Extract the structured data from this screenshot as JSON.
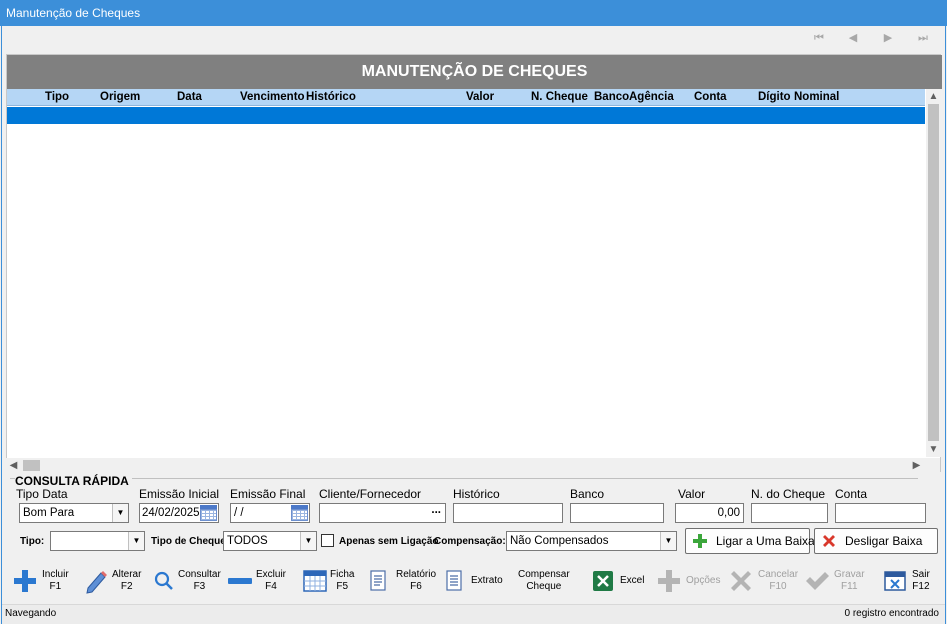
{
  "window": {
    "title": "Manutenção de Cheques"
  },
  "nav": {
    "first": "⏮",
    "prev": "◀",
    "next": "▶",
    "last": "⏭"
  },
  "grid": {
    "title": "MANUTENÇÃO DE CHEQUES",
    "columns": [
      "Tipo",
      "Origem",
      "Data",
      "Vencimento",
      "Histórico",
      "Valor",
      "N. Cheque",
      "Banco",
      "Agência",
      "Conta",
      "Dígito",
      "Nominal"
    ]
  },
  "consulta": {
    "group_label": "CONSULTA RÁPIDA",
    "tipo_data": {
      "label": "Tipo Data",
      "value": "Bom Para"
    },
    "emissao_inicial": {
      "label": "Emissão Inicial",
      "value": "24/02/2025"
    },
    "emissao_final": {
      "label": "Emissão Final",
      "value": " / /"
    },
    "cliente": {
      "label": "Cliente/Fornecedor",
      "value": "",
      "ellipsis": "..."
    },
    "historico": {
      "label": "Histórico",
      "value": ""
    },
    "banco": {
      "label": "Banco",
      "value": ""
    },
    "valor": {
      "label": "Valor",
      "value": "0,00"
    },
    "n_cheque": {
      "label": "N. do Cheque",
      "value": ""
    },
    "conta": {
      "label": "Conta",
      "value": ""
    }
  },
  "filters": {
    "tipo": {
      "label": "Tipo:",
      "value": ""
    },
    "tipo_cheque": {
      "label": "Tipo de Cheque:",
      "value": "TODOS"
    },
    "apenas_sem_ligacao": {
      "label": "Apenas sem Ligação",
      "checked": false
    },
    "compensacao": {
      "label": "Compensação:",
      "value": "Não Compensados"
    },
    "ligar_label": "Ligar a Uma Baixa",
    "desligar_label": "Desligar Baixa"
  },
  "toolbar": {
    "incluir": [
      "Incluir",
      "F1"
    ],
    "alterar": [
      "Alterar",
      "F2"
    ],
    "consultar": [
      "Consultar",
      "F3"
    ],
    "excluir": [
      "Excluir",
      "F4"
    ],
    "ficha": [
      "Ficha",
      "F5"
    ],
    "relatorio": [
      "Relatório",
      "F6"
    ],
    "extrato": [
      "Extrato"
    ],
    "compensar": [
      "Compensar",
      "Cheque"
    ],
    "excel": [
      "Excel"
    ],
    "opcoes": [
      "Opções"
    ],
    "cancelar": [
      "Cancelar",
      "F10"
    ],
    "gravar": [
      "Gravar",
      "F11"
    ],
    "sair": [
      "Sair",
      "F12"
    ]
  },
  "status": {
    "left": "Navegando",
    "right": "0 registro encontrado"
  },
  "colors": {
    "title_bar": "#3c8fd9",
    "grid_header": "#b5d6f5",
    "selection": "#0078d7",
    "grid_title_bg": "#808080"
  }
}
